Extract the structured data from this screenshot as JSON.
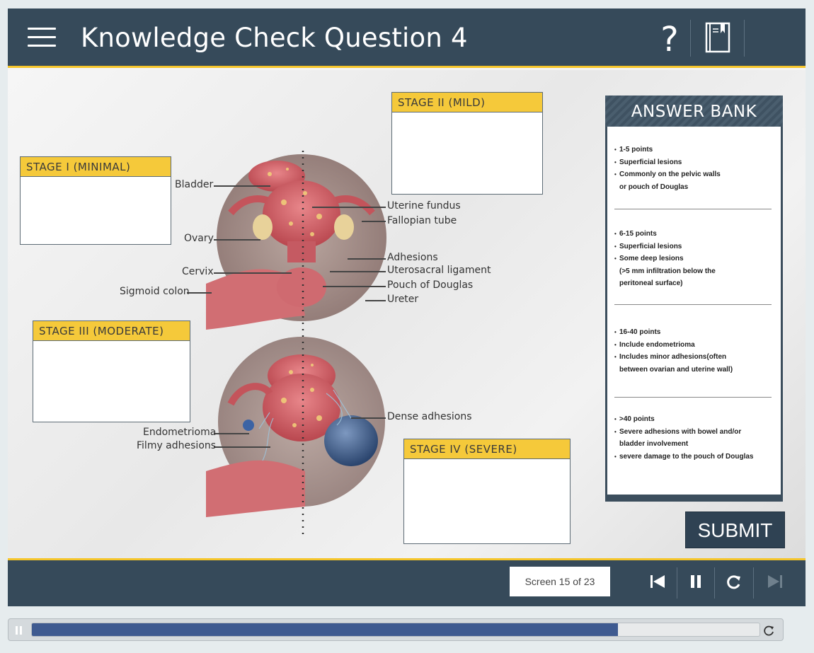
{
  "header": {
    "title": "Knowledge Check Question 4",
    "help_glyph": "?"
  },
  "stages": {
    "stage1": "STAGE I (MINIMAL)",
    "stage2": "STAGE II (MILD)",
    "stage3": "STAGE III (MODERATE)",
    "stage4": "STAGE IV (SEVERE)"
  },
  "diagram_labels": {
    "bladder": "Bladder",
    "ovary": "Ovary",
    "cervix": "Cervix",
    "sigmoid_colon": "Sigmoid colon",
    "uterine_fundus": "Uterine fundus",
    "fallopian_tube": "Fallopian tube",
    "adhesions": "Adhesions",
    "uterosacral_ligament": "Uterosacral ligament",
    "pouch_of_douglas": "Pouch of Douglas",
    "ureter": "Ureter",
    "dense_adhesions": "Dense adhesions",
    "endometrioma": "Endometrioma",
    "filmy_adhesions": "Filmy adhesions"
  },
  "answer_bank": {
    "title": "ANSWER BANK",
    "groups": [
      {
        "items": [
          "1-5 points",
          "Superficial lesions",
          "Commonly on the pelvic walls"
        ],
        "cont": [
          "or pouch of Douglas"
        ]
      },
      {
        "items": [
          "6-15 points",
          "Superficial lesions",
          "Some deep lesions"
        ],
        "cont": [
          "(>5 mm infiltration below the",
          "peritoneal surface)"
        ]
      },
      {
        "items": [
          "16-40 points",
          "Include endometrioma",
          "Includes minor adhesions(often"
        ],
        "cont": [
          "between ovarian and uterine wall)"
        ]
      },
      {
        "items": [
          ">40 points",
          "Severe adhesions with bowel and/or"
        ],
        "cont": [
          "bladder involvement"
        ],
        "after": [
          "severe damage to the pouch of Douglas"
        ]
      }
    ]
  },
  "submit_label": "SUBMIT",
  "footer": {
    "screen_count": "Screen 15 of 23"
  },
  "progress": {
    "fraction": 0.805
  },
  "colors": {
    "header_bg": "#364a5a",
    "accent": "#f5c52a",
    "stage_header": "#f5c93a",
    "progress_fill": "#3e5a90"
  }
}
